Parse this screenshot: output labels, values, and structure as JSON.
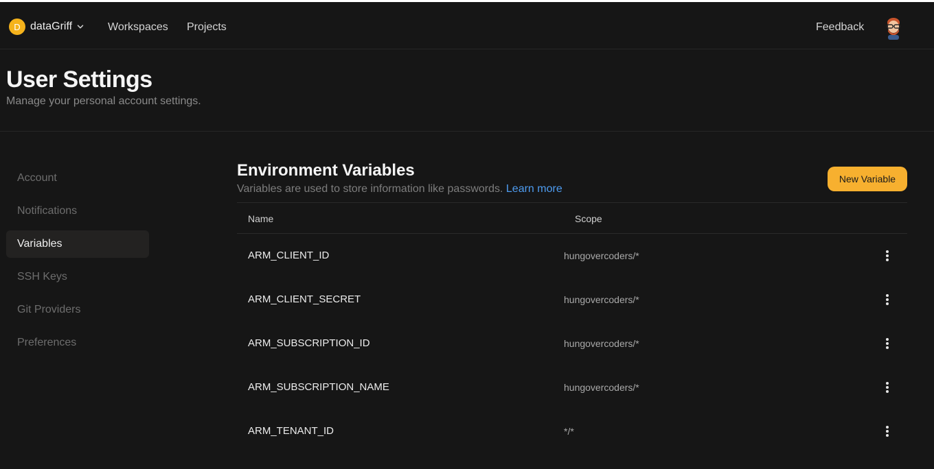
{
  "topbar": {
    "org_initial": "D",
    "org_name": "dataGriff",
    "nav": [
      "Workspaces",
      "Projects"
    ],
    "feedback": "Feedback"
  },
  "header": {
    "title": "User Settings",
    "subtitle": "Manage your personal account settings."
  },
  "sidebar": {
    "items": [
      {
        "label": "Account"
      },
      {
        "label": "Notifications"
      },
      {
        "label": "Variables"
      },
      {
        "label": "SSH Keys"
      },
      {
        "label": "Git Providers"
      },
      {
        "label": "Preferences"
      }
    ],
    "active": "Variables"
  },
  "main": {
    "title": "Environment Variables",
    "description": "Variables are used to store information like passwords.",
    "learn_more": "Learn more",
    "new_button": "New Variable",
    "columns": {
      "name": "Name",
      "scope": "Scope"
    },
    "rows": [
      {
        "name": "ARM_CLIENT_ID",
        "scope": "hungovercoders/*"
      },
      {
        "name": "ARM_CLIENT_SECRET",
        "scope": "hungovercoders/*"
      },
      {
        "name": "ARM_SUBSCRIPTION_ID",
        "scope": "hungovercoders/*"
      },
      {
        "name": "ARM_SUBSCRIPTION_NAME",
        "scope": "hungovercoders/*"
      },
      {
        "name": "ARM_TENANT_ID",
        "scope": "*/*"
      }
    ]
  },
  "colors": {
    "background": "#161616",
    "accent": "#f7b02f",
    "link": "#4e9cf0",
    "org_badge": "#f5b31c"
  },
  "icons": {
    "org_dropdown": "chevron-down-icon",
    "row_menu": "kebab-menu-icon",
    "user": "avatar"
  }
}
